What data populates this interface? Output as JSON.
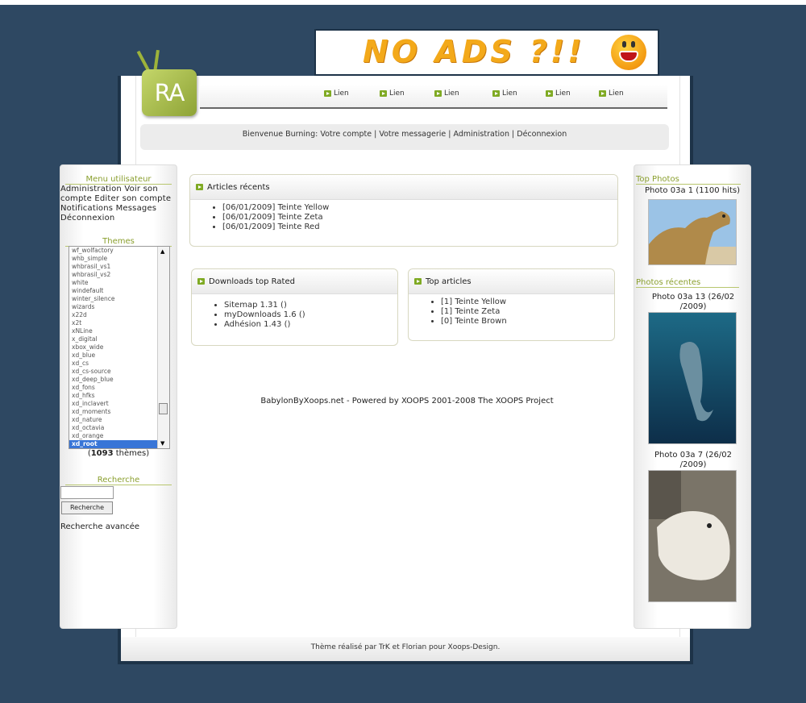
{
  "banner": {
    "text": "NO ADS ?!!"
  },
  "logo": {
    "text": "RA"
  },
  "nav": {
    "items": [
      "Lien",
      "Lien",
      "Lien",
      "Lien",
      "Lien",
      "Lien"
    ]
  },
  "welcome": {
    "text": "Bienvenue Burning: Votre compte | Votre messagerie | Administration | Déconnexion"
  },
  "left": {
    "menu_title": "Menu utilisateur",
    "menu_text": "Administration Voir son compte Editer son compte Notifications Messages Déconnexion",
    "themes_title": "Themes",
    "themes": [
      "wf_wolfactory",
      "whb_simple",
      "whbrasil_vs1",
      "whbrasil_vs2",
      "white",
      "windefault",
      "winter_silence",
      "wizards",
      "x22d",
      "x2t",
      "xNLine",
      "x_digital",
      "xbox_wide",
      "xd_blue",
      "xd_cs",
      "xd_cs-source",
      "xd_deep_blue",
      "xd_fons",
      "xd_hfks",
      "xd_inclavert",
      "xd_moments",
      "xd_nature",
      "xd_octavia",
      "xd_orange",
      "xd_root"
    ],
    "themes_count_prefix": "(",
    "themes_count": "1093",
    "themes_count_suffix": " thèmes)",
    "search_title": "Recherche",
    "search_button": "Recherche",
    "search_value": "",
    "advanced_search": "Recherche avancée"
  },
  "center": {
    "recent_title": "Articles récents",
    "recent_items": [
      "[06/01/2009] Teinte Yellow",
      "[06/01/2009] Teinte Zeta",
      "[06/01/2009] Teinte Red"
    ],
    "downloads_title": "Downloads top Rated",
    "downloads_items": [
      "Sitemap 1.31 ()",
      "myDownloads 1.6 ()",
      "Adhésion 1.43 ()"
    ],
    "top_title": "Top articles",
    "top_items": [
      "[1] Teinte Yellow",
      "[1] Teinte Zeta",
      "[0] Teinte Brown"
    ],
    "powered": "BabylonByXoops.net - Powered by XOOPS 2001-2008 The XOOPS Project"
  },
  "right": {
    "top_photos_title": "Top Photos",
    "top_photo_caption": "Photo 03a 1 (1100 hits)",
    "recent_photos_title": "Photos récentes",
    "recent_photo1_caption": "Photo 03a 13 (26/02 /2009)",
    "recent_photo2_caption": "Photo 03a 7 (26/02 /2009)"
  },
  "footer": {
    "text": "Thème réalisé par TrK et Florian pour Xoops-Design."
  }
}
